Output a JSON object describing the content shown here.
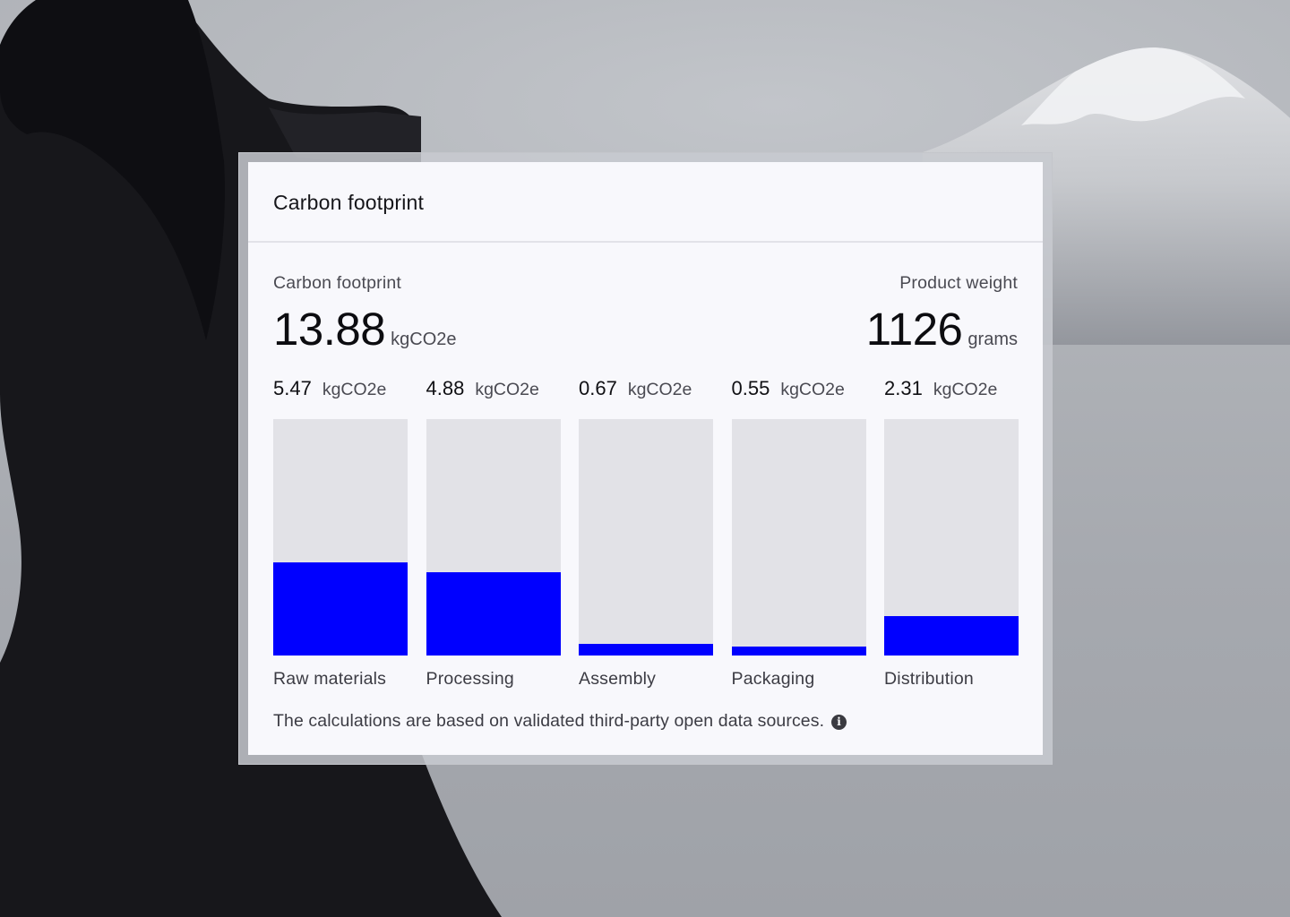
{
  "card": {
    "title": "Carbon footprint"
  },
  "summary": {
    "carbon_label": "Carbon footprint",
    "carbon_value": "13.88",
    "carbon_unit": "kgCO2e",
    "weight_label": "Product weight",
    "weight_value": "1126",
    "weight_unit": "grams"
  },
  "colors": {
    "bar_fill": "#0000ff",
    "bar_track": "#e2e2e7"
  },
  "chart_data": {
    "type": "bar",
    "categories": [
      "Raw materials",
      "Processing",
      "Assembly",
      "Packaging",
      "Distribution"
    ],
    "value_labels": [
      "5.47",
      "4.88",
      "0.67",
      "0.55",
      "2.31"
    ],
    "values": [
      5.47,
      4.88,
      0.67,
      0.55,
      2.31
    ],
    "unit": "kgCO2e",
    "ylim": [
      0,
      13.88
    ]
  },
  "footnote": {
    "text": "The calculations are based on validated third-party open data sources.",
    "icon": "info-icon"
  }
}
